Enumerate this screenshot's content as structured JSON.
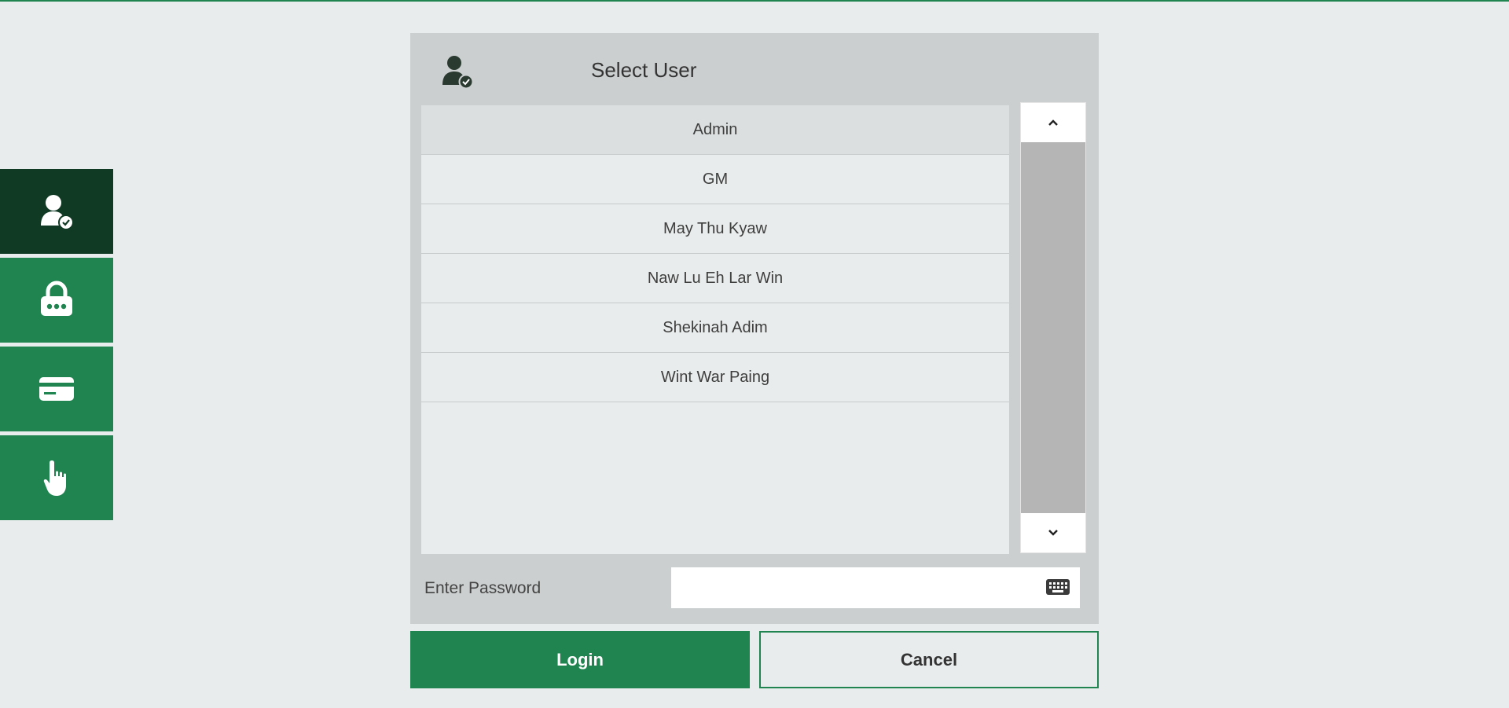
{
  "colors": {
    "accent": "#1f8450",
    "accent_dark": "#113a24",
    "background": "#e8ecec",
    "panel": "#cbcfcf"
  },
  "rail": {
    "items": [
      {
        "icon": "user-check-icon",
        "active": true
      },
      {
        "icon": "lock-password-icon",
        "active": false
      },
      {
        "icon": "card-icon",
        "active": false
      },
      {
        "icon": "hand-pointer-icon",
        "active": false
      }
    ]
  },
  "dialog": {
    "title": "Select User",
    "header_icon": "user-check-icon",
    "users": [
      "Admin",
      "GM",
      "May Thu Kyaw",
      "Naw Lu Eh Lar Win",
      "Shekinah Adim",
      "Wint War Paing"
    ],
    "selected_user": "Admin",
    "scroll_up_icon": "chevron-up-icon",
    "scroll_down_icon": "chevron-down-icon",
    "password_label": "Enter Password",
    "password_value": "",
    "keyboard_icon": "keyboard-icon"
  },
  "buttons": {
    "login_label": "Login",
    "cancel_label": "Cancel"
  }
}
